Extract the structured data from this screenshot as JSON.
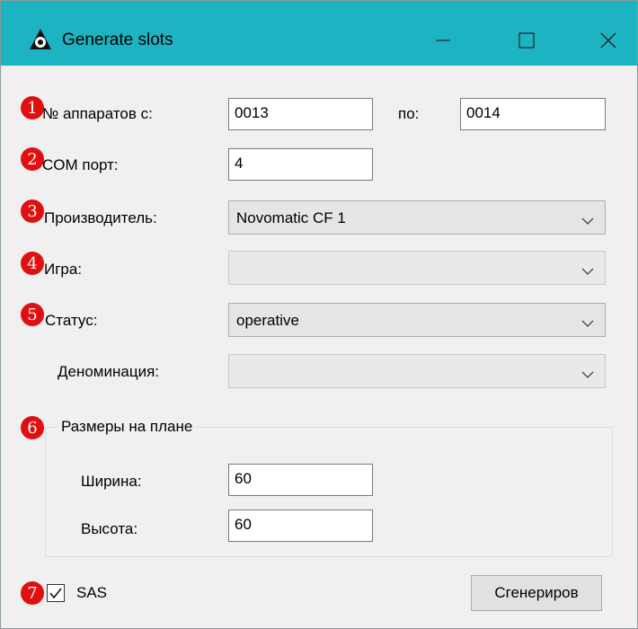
{
  "window": {
    "title": "Generate slots",
    "icon": "app-logo-icon",
    "controls": [
      "minimize-icon",
      "maximize-icon",
      "close-icon"
    ]
  },
  "form": {
    "machines_from_label": "№ аппаратов с:",
    "machines_from_value": "0013",
    "machines_to_label": "по:",
    "machines_to_value": "0014",
    "com_port_label": "COM порт:",
    "com_port_value": "4",
    "manufacturer_label": "Производитель:",
    "manufacturer_value": "Novomatic CF 1",
    "game_label": "Игра:",
    "game_value": "",
    "status_label": "Статус:",
    "status_value": "operative",
    "denomination_label": "Деноминация:",
    "denomination_value": ""
  },
  "size_group": {
    "title": "Размеры на плане",
    "width_label": "Ширина:",
    "width_value": "60",
    "height_label": "Высота:",
    "height_value": "60"
  },
  "sas": {
    "label": "SAS",
    "checked": true
  },
  "generate_button": "Сгенериров",
  "annotations": [
    "1",
    "2",
    "3",
    "4",
    "5",
    "6",
    "7"
  ],
  "colors": {
    "titlebar": "#1cb4c3",
    "badge": "#e01010",
    "window_bg": "#f0f0f0"
  }
}
